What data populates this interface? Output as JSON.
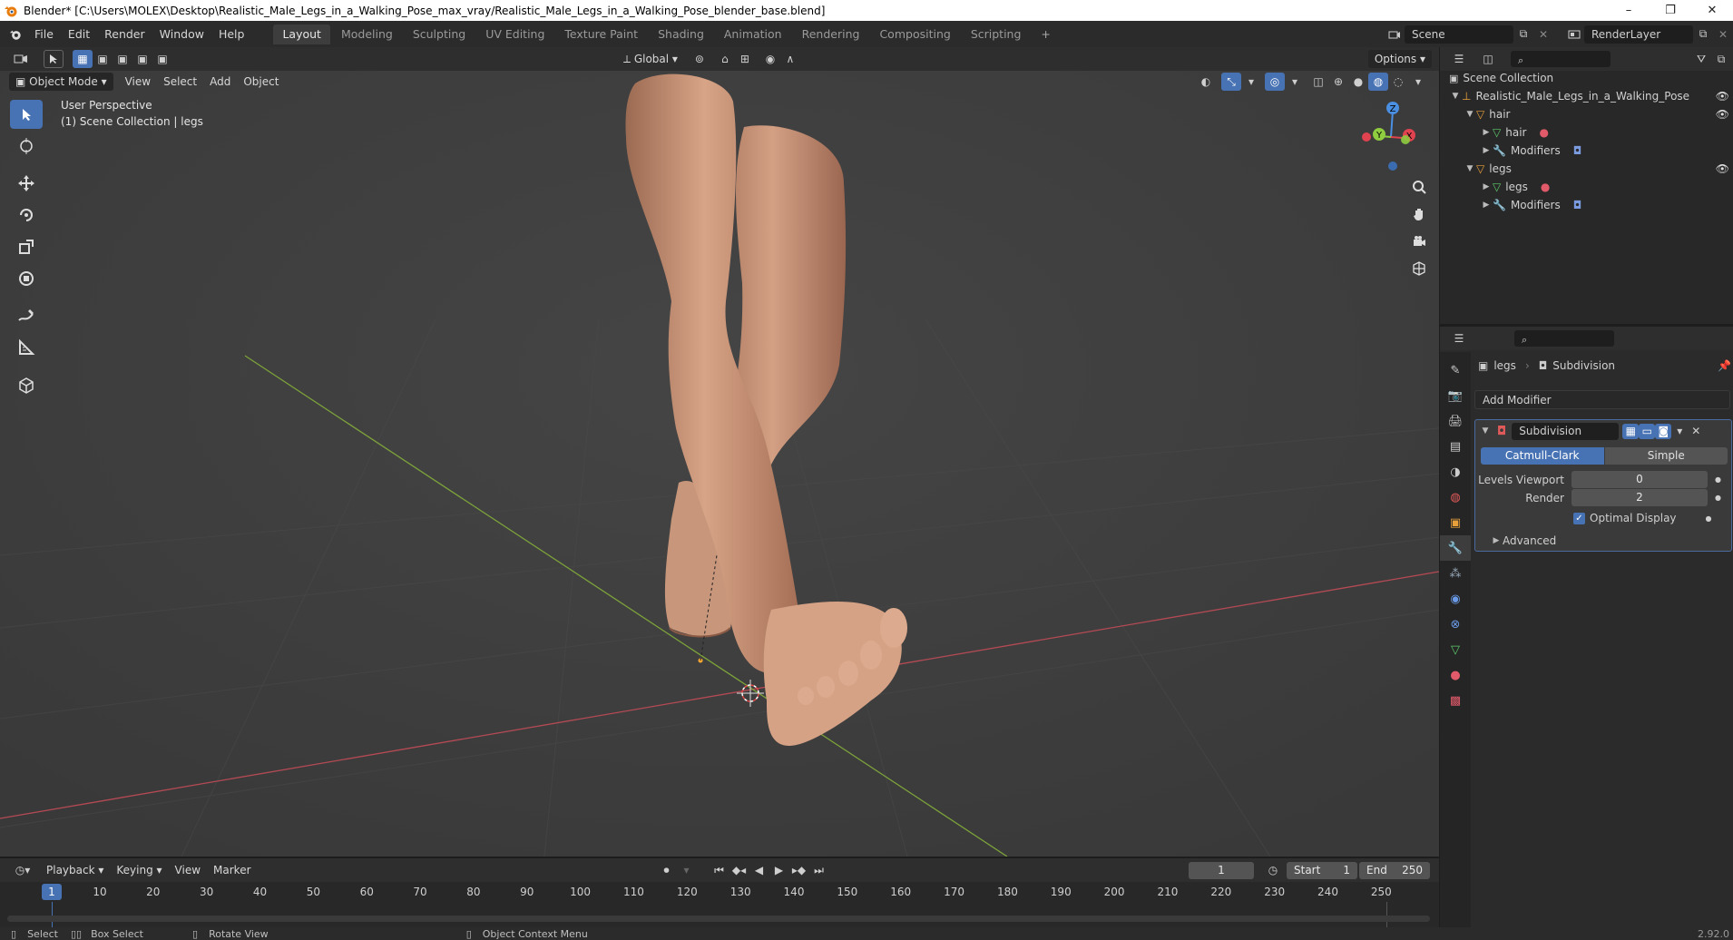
{
  "window": {
    "title": "Blender* [C:\\Users\\MOLEX\\Desktop\\Realistic_Male_Legs_in_a_Walking_Pose_max_vray/Realistic_Male_Legs_in_a_Walking_Pose_blender_base.blend]",
    "minimize": "–",
    "restore": "❐",
    "close": "✕"
  },
  "menu": {
    "file": "File",
    "edit": "Edit",
    "render": "Render",
    "window": "Window",
    "help": "Help"
  },
  "workspaces": [
    {
      "label": "Layout",
      "active": true
    },
    {
      "label": "Modeling"
    },
    {
      "label": "Sculpting"
    },
    {
      "label": "UV Editing"
    },
    {
      "label": "Texture Paint"
    },
    {
      "label": "Shading"
    },
    {
      "label": "Animation"
    },
    {
      "label": "Rendering"
    },
    {
      "label": "Compositing"
    },
    {
      "label": "Scripting"
    }
  ],
  "scene": {
    "name": "Scene",
    "render_layer": "RenderLayer"
  },
  "viewport": {
    "transform_orientation": "Global",
    "options": "Options",
    "mode": "Object Mode",
    "menus": {
      "view": "View",
      "select": "Select",
      "add": "Add",
      "object": "Object"
    },
    "perspective": "User Perspective",
    "collection_info": "(1) Scene Collection | legs",
    "gizmo": {
      "z": "Z",
      "y": "Y",
      "x": "X"
    }
  },
  "outliner": {
    "root": "Scene Collection",
    "collection": "Realistic_Male_Legs_in_a_Walking_Pose",
    "items": [
      {
        "label": "hair"
      },
      {
        "label": "hair"
      },
      {
        "label": "Modifiers"
      },
      {
        "label": "legs"
      },
      {
        "label": "legs"
      },
      {
        "label": "Modifiers"
      }
    ]
  },
  "properties": {
    "breadcrumb_object": "legs",
    "breadcrumb_modifier": "Subdivision",
    "add_modifier": "Add Modifier",
    "modifier": {
      "name": "Subdivision",
      "type_catmull": "Catmull-Clark",
      "type_simple": "Simple",
      "levels_viewport_label": "Levels Viewport",
      "levels_viewport_value": "0",
      "render_label": "Render",
      "render_value": "2",
      "optimal_display": "Optimal Display",
      "advanced": "Advanced"
    }
  },
  "timeline": {
    "playback": "Playback",
    "keying": "Keying",
    "view": "View",
    "marker": "Marker",
    "current_frame": "1",
    "start_label": "Start",
    "start": "1",
    "end_label": "End",
    "end": "250",
    "ticks": [
      "10",
      "20",
      "30",
      "40",
      "50",
      "60",
      "70",
      "80",
      "90",
      "100",
      "110",
      "120",
      "130",
      "140",
      "150",
      "160",
      "170",
      "180",
      "190",
      "200",
      "210",
      "220",
      "230",
      "240",
      "250"
    ],
    "playhead": "1"
  },
  "statusbar": {
    "select": "Select",
    "box_select": "Box Select",
    "rotate_view": "Rotate View",
    "context_menu": "Object Context Menu",
    "version": "2.92.0"
  },
  "colors": {
    "accent": "#4772b3",
    "x_axis": "#e0424f",
    "y_axis": "#8fcc40",
    "z_axis": "#4a8fe2"
  }
}
